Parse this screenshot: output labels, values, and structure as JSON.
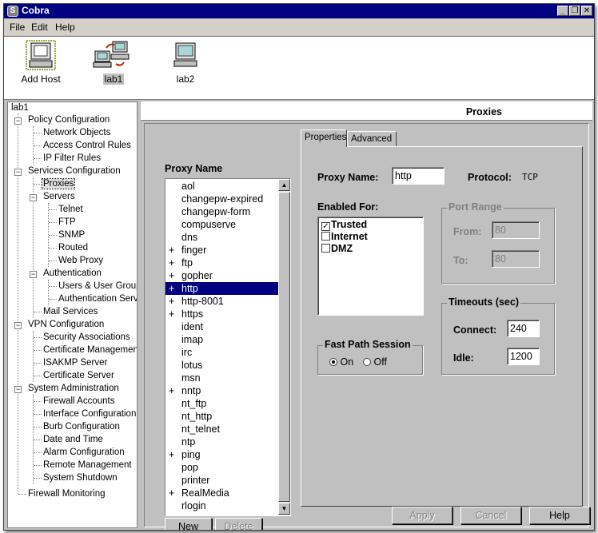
{
  "window": {
    "title": "Cobra",
    "app_icon": "snake-icon",
    "controls": {
      "minimize": "_",
      "restore": "❐",
      "close": "✕"
    }
  },
  "menu": [
    "File",
    "Edit",
    "Help"
  ],
  "hosts": [
    {
      "label": "Add Host",
      "icon": "computer-add-icon"
    },
    {
      "label": "lab1",
      "icon": "network-computers-icon",
      "selected": true
    },
    {
      "label": "lab2",
      "icon": "computer-icon"
    }
  ],
  "tree": {
    "root": "lab1",
    "policy": {
      "label": "Policy Configuration",
      "children": [
        "Network Objects",
        "Access Control Rules",
        "IP Filter Rules"
      ]
    },
    "services": {
      "label": "Services Configuration",
      "proxies": "Proxies",
      "servers": {
        "label": "Servers",
        "children": [
          "Telnet",
          "FTP",
          "SNMP",
          "Routed",
          "Web Proxy"
        ]
      },
      "auth": {
        "label": "Authentication",
        "children": [
          "Users & User Groups",
          "Authentication Servic"
        ]
      },
      "mail": "Mail Services"
    },
    "vpn": {
      "label": "VPN Configuration",
      "children": [
        "Security Associations",
        "Certificate Management",
        "ISAKMP Server",
        "Certificate Server"
      ]
    },
    "sysadmin": {
      "label": "System Administration",
      "children": [
        "Firewall Accounts",
        "Interface Configuration",
        "Burb Configuration",
        "Date and Time",
        "Alarm Configuration",
        "Remote Management",
        "System Shutdown"
      ]
    },
    "monitoring": "Firewall Monitoring"
  },
  "pane": {
    "title": "Proxies",
    "proxy_name_header": "Proxy Name",
    "proxies": [
      {
        "prefix": "",
        "name": "aol"
      },
      {
        "prefix": "",
        "name": "changepw-expired"
      },
      {
        "prefix": "",
        "name": "changepw-form"
      },
      {
        "prefix": "",
        "name": "compuserve"
      },
      {
        "prefix": "",
        "name": "dns"
      },
      {
        "prefix": "+",
        "name": "finger"
      },
      {
        "prefix": "+",
        "name": "ftp"
      },
      {
        "prefix": "+",
        "name": "gopher"
      },
      {
        "prefix": "+",
        "name": "http",
        "selected": true
      },
      {
        "prefix": "+",
        "name": "http-8001"
      },
      {
        "prefix": "+",
        "name": "https"
      },
      {
        "prefix": "",
        "name": "ident"
      },
      {
        "prefix": "",
        "name": "imap"
      },
      {
        "prefix": "",
        "name": "irc"
      },
      {
        "prefix": "",
        "name": "lotus"
      },
      {
        "prefix": "",
        "name": "msn"
      },
      {
        "prefix": "+",
        "name": "nntp"
      },
      {
        "prefix": "",
        "name": "nt_ftp"
      },
      {
        "prefix": "",
        "name": "nt_http"
      },
      {
        "prefix": "",
        "name": "nt_telnet"
      },
      {
        "prefix": "",
        "name": "ntp"
      },
      {
        "prefix": "+",
        "name": "ping"
      },
      {
        "prefix": "",
        "name": "pop"
      },
      {
        "prefix": "",
        "name": "printer"
      },
      {
        "prefix": "+",
        "name": "RealMedia"
      },
      {
        "prefix": "",
        "name": "rlogin"
      }
    ],
    "new_button": "New",
    "delete_button": "Delete",
    "tabs": [
      "Properties",
      "Advanced"
    ],
    "proxy_name_label": "Proxy Name:",
    "proxy_name_value": "http",
    "protocol_label": "Protocol:",
    "protocol_value": "TCP",
    "enabled_for_label": "Enabled For:",
    "enabled_for": [
      {
        "label": "Trusted",
        "checked": true
      },
      {
        "label": "Internet",
        "checked": false
      },
      {
        "label": "DMZ",
        "checked": false
      }
    ],
    "port_range": {
      "legend": "Port Range",
      "from_label": "From:",
      "from_value": "80",
      "to_label": "To:",
      "to_value": "80"
    },
    "timeouts": {
      "legend": "Timeouts (sec)",
      "connect_label": "Connect:",
      "connect_value": "240",
      "idle_label": "Idle:",
      "idle_value": "1200"
    },
    "fast_path": {
      "legend": "Fast Path Session",
      "on_label": "On",
      "off_label": "Off",
      "selected": "On"
    },
    "apply_button": "Apply",
    "cancel_button": "Cancel",
    "help_button": "Help"
  }
}
